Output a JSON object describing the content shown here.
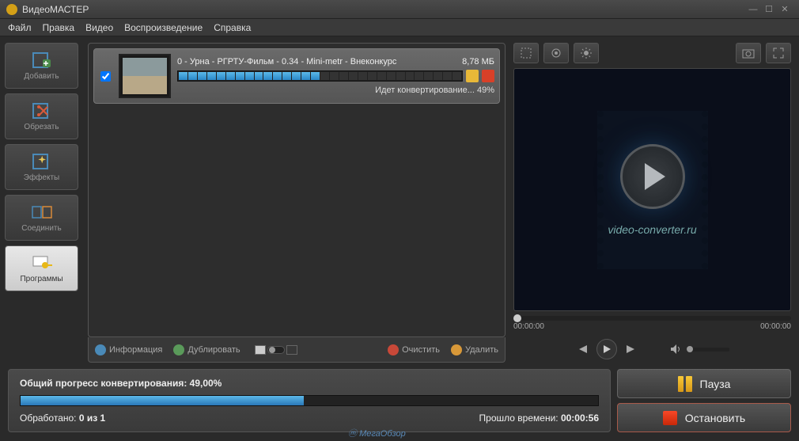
{
  "app": {
    "title": "ВидеоМАСТЕР"
  },
  "menu": {
    "file": "Файл",
    "edit": "Правка",
    "video": "Видео",
    "playback": "Воспроизведение",
    "help": "Справка"
  },
  "sidebar": {
    "add": "Добавить",
    "cut": "Обрезать",
    "effects": "Эффекты",
    "join": "Соединить",
    "programs": "Программы"
  },
  "item": {
    "title": "0 - Урна - РГРТУ-Фильм - 0.34 - Mini-metr - Внеконкурс",
    "size": "8,78 МБ",
    "status": "Идет конвертирование... 49%"
  },
  "listbar": {
    "info": "Информация",
    "dup": "Дублировать",
    "clear": "Очистить",
    "del": "Удалить"
  },
  "preview": {
    "url": "video-converter.ru",
    "t1": "00:00:00",
    "t2": "00:00:00"
  },
  "progress": {
    "label": "Общий прогресс конвертирования: 49,00%",
    "processed_lbl": "Обработано:",
    "processed_val": "0 из 1",
    "elapsed_lbl": "Прошло времени:",
    "elapsed_val": "00:00:56"
  },
  "actions": {
    "pause": "Пауза",
    "stop": "Остановить"
  },
  "watermark": "МегаОбзор"
}
